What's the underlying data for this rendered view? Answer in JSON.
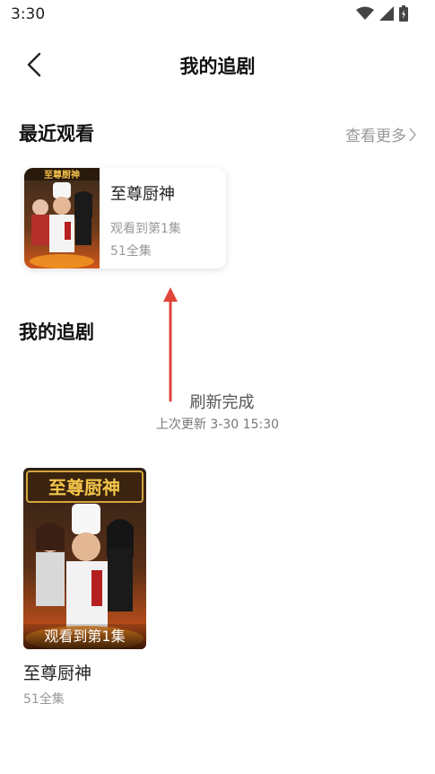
{
  "status_bar": {
    "time": "3:30"
  },
  "nav": {
    "title": "我的追剧"
  },
  "recent": {
    "title": "最近观看",
    "see_more": "查看更多",
    "item": {
      "name": "至尊厨神",
      "progress": "观看到第1集",
      "episodes": "51全集",
      "poster_title": "至尊厨神"
    }
  },
  "refresh": {
    "done": "刷新完成",
    "last_update": "上次更新 3-30 15:30"
  },
  "following": {
    "title": "我的追剧",
    "item": {
      "name": "至尊厨神",
      "progress": "观看到第1集",
      "episodes": "51全集",
      "poster_title": "至尊厨神"
    }
  },
  "colors": {
    "arrow": "#e0453a",
    "muted": "#999999",
    "text": "#1a1a1a"
  }
}
